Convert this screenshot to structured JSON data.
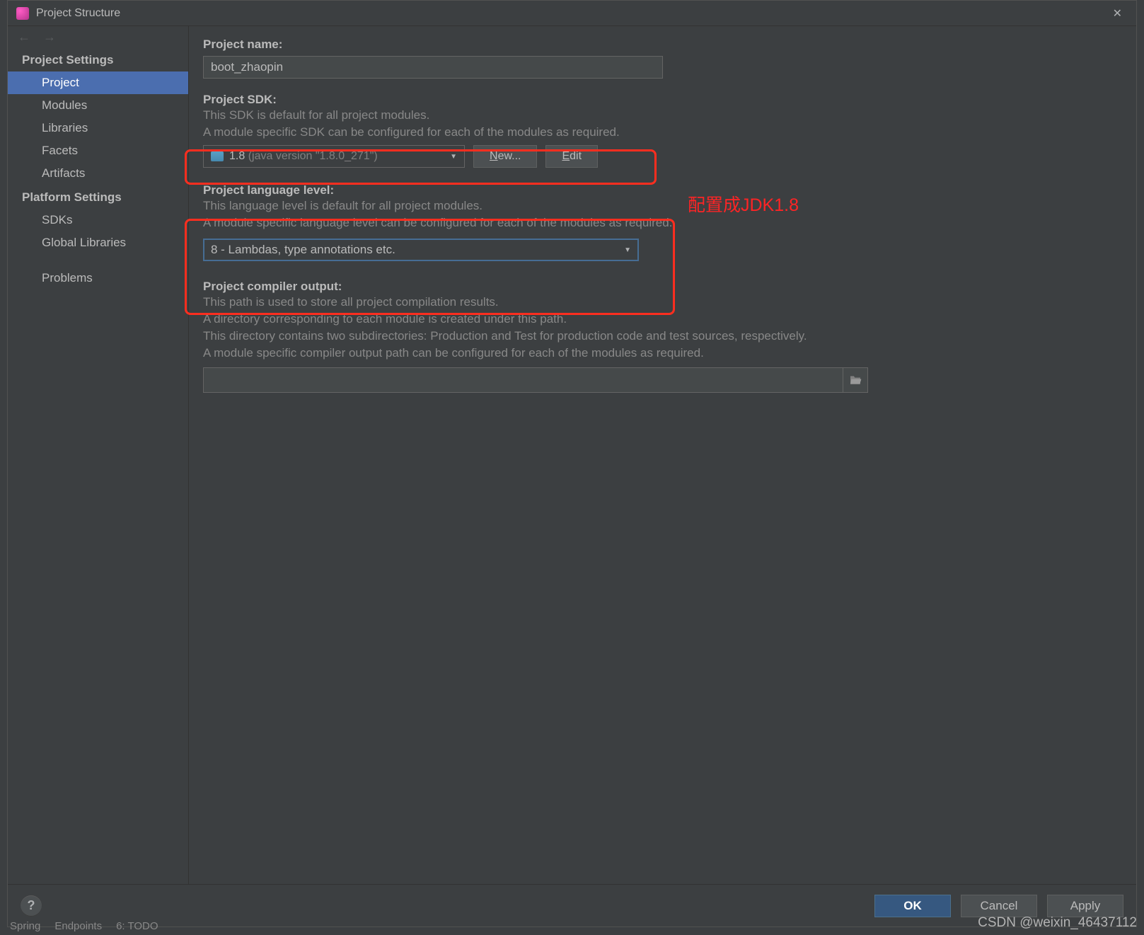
{
  "window": {
    "title": "Project Structure"
  },
  "sidebar": {
    "group1": "Project Settings",
    "items1": [
      "Project",
      "Modules",
      "Libraries",
      "Facets",
      "Artifacts"
    ],
    "group2": "Platform Settings",
    "items2": [
      "SDKs",
      "Global Libraries"
    ],
    "problems": "Problems"
  },
  "project_name": {
    "label": "Project name:",
    "value": "boot_zhaopin"
  },
  "project_sdk": {
    "label": "Project SDK:",
    "desc1": "This SDK is default for all project modules.",
    "desc2": "A module specific SDK can be configured for each of the modules as required.",
    "selected_main": "1.8",
    "selected_dim": " (java version \"1.8.0_271\")",
    "new_btn_pre": "N",
    "new_btn_rest": "ew...",
    "edit_btn_pre": "E",
    "edit_btn_rest": "dit"
  },
  "lang_level": {
    "label": "Project language level:",
    "desc1": "This language level is default for all project modules.",
    "desc2": "A module specific language level can be configured for each of the modules as required.",
    "selected": "8 - Lambdas, type annotations etc."
  },
  "compiler_out": {
    "label": "Project compiler output:",
    "desc1": "This path is used to store all project compilation results.",
    "desc2": "A directory corresponding to each module is created under this path.",
    "desc3": "This directory contains two subdirectories: Production and Test for production code and test sources, respectively.",
    "desc4": "A module specific compiler output path can be configured for each of the modules as required.",
    "value": ""
  },
  "annotation": "配置成JDK1.8",
  "footer": {
    "ok": "OK",
    "cancel": "Cancel",
    "apply": "Apply"
  },
  "statusbar": {
    "spring": "Spring",
    "endpoints": "Endpoints",
    "todo": "6: TODO"
  },
  "watermark": "CSDN @weixin_46437112"
}
